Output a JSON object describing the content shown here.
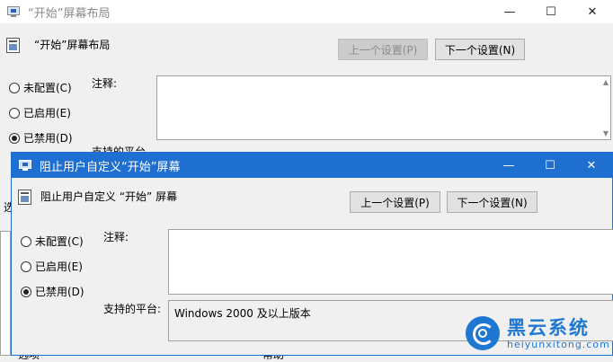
{
  "bg_window": {
    "title": "“开始”屏幕布局",
    "header_title": "“开始”屏幕布局",
    "prev_button": "上一个设置(P)",
    "next_button": "下一个设置(N)",
    "radio_not_configured": "未配置(C)",
    "radio_enabled": "已启用(E)",
    "radio_disabled": "已禁用(D)",
    "comment_label": "注释:",
    "platform_label_partial": "支持的平台",
    "left_clip_1": "选",
    "left_clip_2": "选项",
    "right_clip": "帮助"
  },
  "fg_window": {
    "title": "阻止用户自定义“开始”屏幕",
    "header_title": "阻止用户自定义 “开始” 屏幕",
    "prev_button": "上一个设置(P)",
    "next_button": "下一个设置(N)",
    "radio_not_configured": "未配置(C)",
    "radio_enabled": "已启用(E)",
    "radio_disabled": "已禁用(D)",
    "selected": "disabled",
    "comment_label": "注释:",
    "comment_value": "",
    "platform_label": "支持的平台:",
    "platform_value": "Windows 2000 及以上版本"
  },
  "controls": {
    "minimize": "—",
    "maximize": "☐",
    "close": "✕"
  },
  "watermark": {
    "cn": "黑云系统",
    "en": "heiyunxitong.com"
  },
  "colors": {
    "accent": "#1e6fcf",
    "logo": "#1e78d2"
  }
}
